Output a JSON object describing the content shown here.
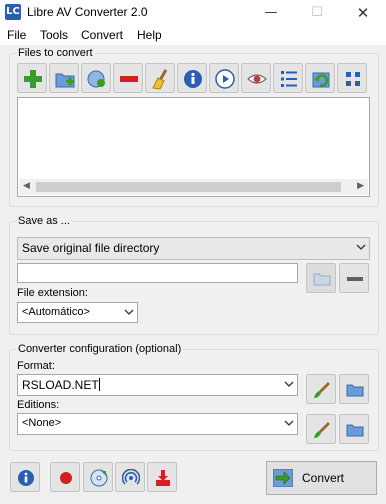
{
  "window": {
    "title": "Libre AV Converter 2.0",
    "app_icon_text": "LC",
    "minimize_glyph": "—",
    "maximize_glyph": "☐",
    "close_glyph": "✕"
  },
  "menu": [
    "File",
    "Tools",
    "Convert",
    "Help"
  ],
  "files_group": {
    "label": "Files to convert",
    "toolbar_icons": [
      "add-file-icon",
      "add-folder-icon",
      "add-url-icon",
      "remove-icon",
      "clear-list-icon",
      "info-icon",
      "play-icon",
      "preview-icon",
      "list-view-icon",
      "refresh-icon",
      "grid-view-icon"
    ]
  },
  "save_group": {
    "label": "Save as ...",
    "location": "Save original file directory",
    "path_value": "",
    "extension_label": "File extension:",
    "extension_value": "<Automático>"
  },
  "config_group": {
    "label": "Converter configuration (optional)",
    "format_label": "Format:",
    "format_value": "RSLOAD.NET",
    "editions_label": "Editions:",
    "editions_value": "<None>"
  },
  "bottom": {
    "convert_label": "Convert"
  },
  "colors": {
    "accent_blue": "#2a5fb0",
    "green": "#3a9a2a",
    "red": "#d42020"
  }
}
